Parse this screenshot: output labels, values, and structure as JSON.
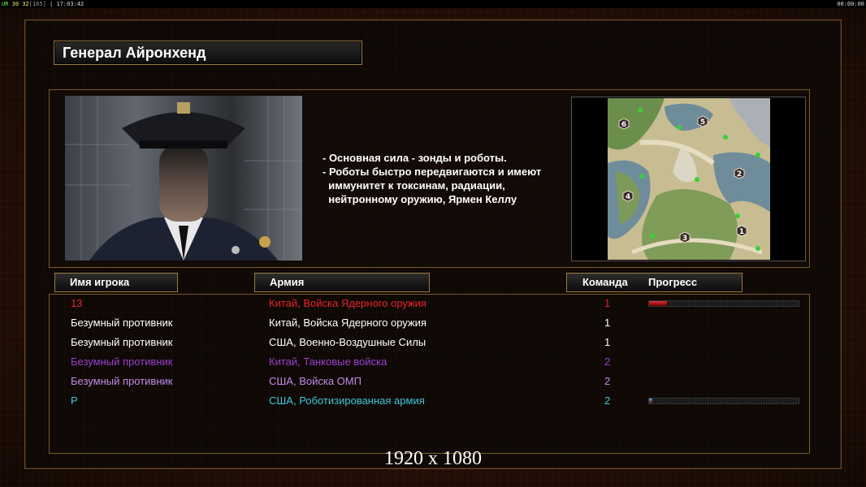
{
  "topbar": {
    "left_tag": "UR",
    "left_a": "30",
    "left_b": "32",
    "left_c": "[165]",
    "left_time": "17:03:42",
    "right_time": "00:00:00"
  },
  "general": {
    "title": "Генерал Айронхенд",
    "description": [
      "- Основная сила - зонды и роботы.",
      "- Роботы быстро передвигаются и имеют",
      "  иммунитет к токсинам, радиации,",
      "  нейтронному оружию, Ярмен Келлу"
    ]
  },
  "map": {
    "start_positions": [
      "1",
      "2",
      "3",
      "4",
      "5",
      "6"
    ]
  },
  "table": {
    "headers": {
      "name": "Имя игрока",
      "army": "Армия",
      "team": "Команда",
      "progress": "Прогресс"
    },
    "rows": [
      {
        "name": "13",
        "army": "Китай, Войска Ядерного оружия",
        "team": "1",
        "color": "#e8222a",
        "progress": 0.12,
        "fill_color": "#d33"
      },
      {
        "name": "Безумный противник",
        "army": "Китай, Войска Ядерного оружия",
        "team": "1",
        "color": "#ffffff"
      },
      {
        "name": "Безумный противник",
        "army": "США, Военно-Воздушные Силы",
        "team": "1",
        "color": "#ffffff"
      },
      {
        "name": "Безумный противник",
        "army": "Китай, Танковые войска",
        "team": "2",
        "color": "#9a3fd0"
      },
      {
        "name": "Безумный противник",
        "army": "США, Войска ОМП",
        "team": "2",
        "color": "#c48ae8"
      },
      {
        "name": "P",
        "army": "США, Роботизированная армия",
        "team": "2",
        "color": "#3fc6d8",
        "progress": 0.02,
        "fill_color": "#5ad"
      }
    ]
  },
  "caption": "1920 x 1080"
}
